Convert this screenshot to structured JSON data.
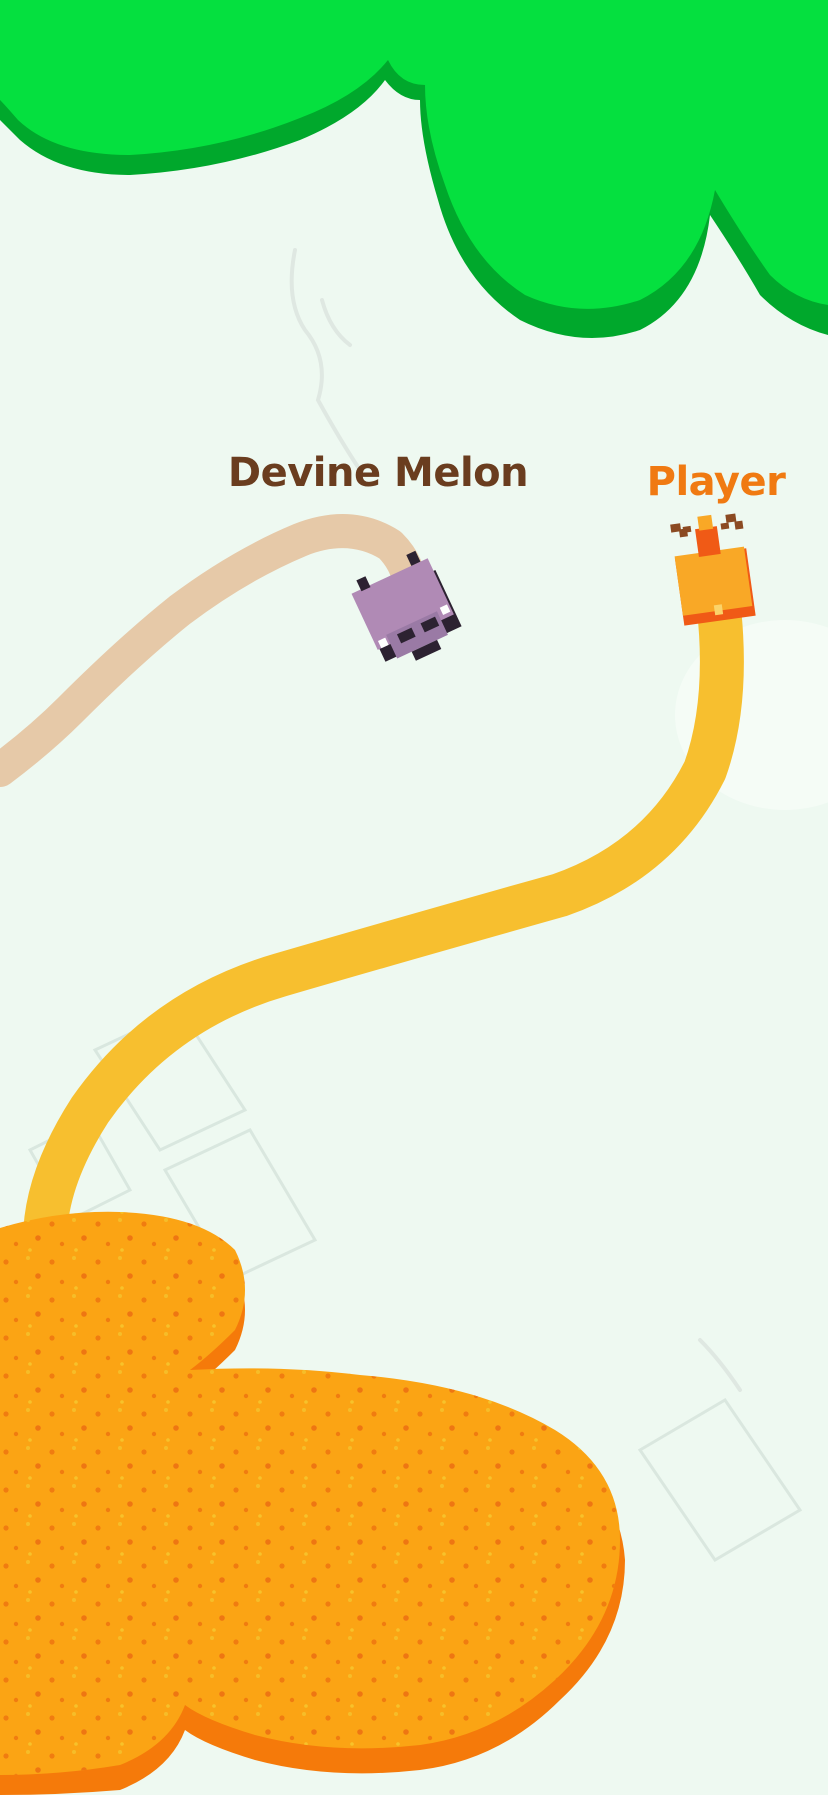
{
  "players": {
    "enemy": {
      "name": "Devine Melon",
      "trail_color": "#e6c9a8",
      "body_color": "#b08ab5",
      "name_color": "#6a3d1f"
    },
    "player": {
      "name": "Player",
      "trail_color": "#f7bf2f",
      "body_color": "#f9a826",
      "name_color": "#f07a12"
    }
  },
  "territories": {
    "green": {
      "color": "#05e03f",
      "edge_color": "#00a82c"
    },
    "orange": {
      "color": "#fba414",
      "edge_color": "#f57a0a"
    }
  },
  "background_color": "#eef9f1"
}
